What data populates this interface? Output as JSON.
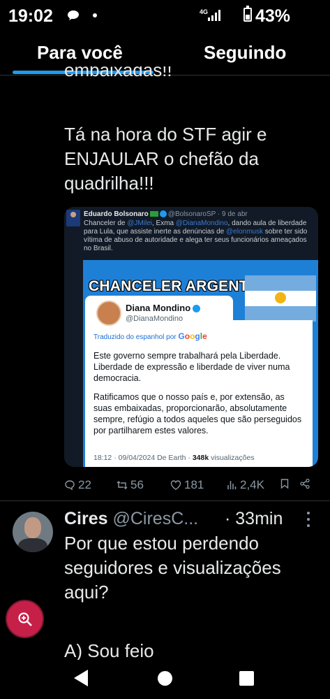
{
  "status": {
    "time": "19:02",
    "network": "4G",
    "battery": "43%"
  },
  "tabs": [
    {
      "label": "Para você"
    },
    {
      "label": "Seguindo"
    }
  ],
  "post1": {
    "fragment": "embaixadas!!",
    "text": "Tá na hora do STF agir e ENJAULAR o chefão da quadrilha!!!"
  },
  "embed": {
    "author": "Eduardo Bolsonaro",
    "handle": "@BolsonaroSP · 9 de abr",
    "text_pre": "Chanceler de ",
    "mention1": "@JMilei",
    "text_mid1": ", Exma ",
    "mention2": "@DianaMondino",
    "text_mid2": ", dando aula de liberdade para Lula, que assiste inerte as denúncias de ",
    "mention3": "@elonmusk",
    "text_post": " sobre ter sido vítima de abuso de autoridade e alega ter seus funcionários ameaçados no Brasil.",
    "banner": "CHANCELER ARGENTINA",
    "card": {
      "name": "Diana Mondino",
      "handle": "@DianaMondino",
      "translated": "Traduzido do espanhol por",
      "translator": "Google",
      "paragraph1": "Este governo sempre trabalhará pela Liberdade. Liberdade de expressão e liberdade de viver numa democracia.",
      "paragraph2": "Ratificamos que o nosso país e, por extensão, as suas embaixadas, proporcionarão, absolutamente sempre, refúgio a todos aqueles que são perseguidos por partilharem estes valores.",
      "meta_pre": "18:12 · 09/04/2024 De Earth · ",
      "views": "348k",
      "meta_post": " visualizações"
    }
  },
  "actions": {
    "replies": "22",
    "reposts": "56",
    "likes": "181",
    "views": "2,4K"
  },
  "post2": {
    "name": "Cires",
    "handle": "@CiresC...",
    "time": "· 33min",
    "text": "Por que estou perdendo seguidores e visualizações aqui?",
    "option": "A) Sou feio"
  },
  "icons": [
    "chat-bubble-icon",
    "signal-icon",
    "battery-icon",
    "reply-icon",
    "repost-icon",
    "like-icon",
    "views-icon",
    "bookmark-icon",
    "share-icon",
    "more-icon",
    "zoom-in-icon",
    "back-icon",
    "home-icon",
    "recents-icon"
  ],
  "colors": {
    "accent": "#1d9bf0",
    "fab": "#c62048",
    "banner_bg": "#1e7fd6"
  }
}
